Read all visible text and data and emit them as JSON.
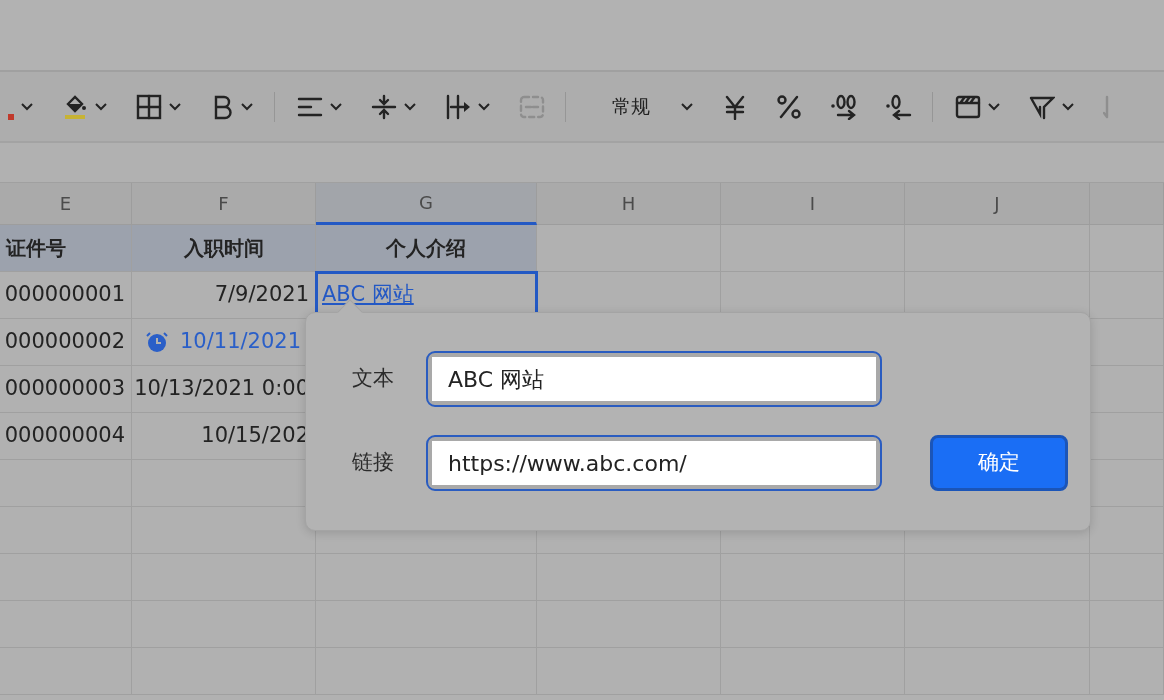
{
  "toolbar": {
    "items": [
      {
        "kind": "font-color",
        "dropdown": true,
        "disabled": false
      },
      {
        "kind": "fill-color",
        "dropdown": true,
        "disabled": false
      },
      {
        "kind": "borders",
        "dropdown": true,
        "disabled": false
      },
      {
        "kind": "bold",
        "dropdown": true,
        "disabled": false
      },
      {
        "kind": "sep"
      },
      {
        "kind": "align",
        "dropdown": true,
        "disabled": false
      },
      {
        "kind": "valign",
        "dropdown": true,
        "disabled": false
      },
      {
        "kind": "wrap",
        "dropdown": true,
        "disabled": false
      },
      {
        "kind": "merge",
        "dropdown": false,
        "disabled": true
      },
      {
        "kind": "sep"
      },
      {
        "kind": "format",
        "label": "常规",
        "dropdown": true,
        "disabled": false
      },
      {
        "kind": "currency",
        "dropdown": false,
        "disabled": false
      },
      {
        "kind": "percent",
        "dropdown": false,
        "disabled": false
      },
      {
        "kind": "inc-decimal",
        "dropdown": false,
        "disabled": false
      },
      {
        "kind": "dec-decimal",
        "dropdown": false,
        "disabled": false
      },
      {
        "kind": "sep"
      },
      {
        "kind": "cond-format",
        "dropdown": true,
        "disabled": false
      },
      {
        "kind": "filter",
        "dropdown": true,
        "disabled": false
      },
      {
        "kind": "sort",
        "dropdown": false,
        "disabled": true
      }
    ]
  },
  "columns": [
    {
      "label": "E",
      "selected": false
    },
    {
      "label": "F",
      "selected": false
    },
    {
      "label": "G",
      "selected": true
    },
    {
      "label": "H",
      "selected": false
    },
    {
      "label": "I",
      "selected": false
    },
    {
      "label": "J",
      "selected": false
    }
  ],
  "header_row": [
    "证件号",
    "入职时间",
    "个人介绍"
  ],
  "rows": [
    {
      "cells": [
        {
          "text": "000000001",
          "kind": "number",
          "selected": false
        },
        {
          "text": "7/9/2021",
          "kind": "number",
          "selected": false
        },
        {
          "text": "ABC 网站",
          "kind": "link",
          "selected": true
        }
      ]
    },
    {
      "cells": [
        {
          "text": "000000002",
          "kind": "number",
          "selected": false
        },
        {
          "text": "10/11/2021",
          "kind": "reminder",
          "selected": false
        }
      ]
    },
    {
      "cells": [
        {
          "text": "000000003",
          "kind": "number",
          "selected": false
        },
        {
          "text": "10/13/2021 0:00",
          "kind": "number",
          "selected": false
        }
      ]
    },
    {
      "cells": [
        {
          "text": "000000004",
          "kind": "number",
          "selected": false
        },
        {
          "text": "10/15/202",
          "kind": "number",
          "selected": false
        }
      ]
    }
  ],
  "link_popup": {
    "fields": [
      {
        "label": "文本",
        "value": "ABC 网站"
      },
      {
        "label": "链接",
        "value": "https://www.abc.com/"
      }
    ],
    "button": "确定"
  }
}
